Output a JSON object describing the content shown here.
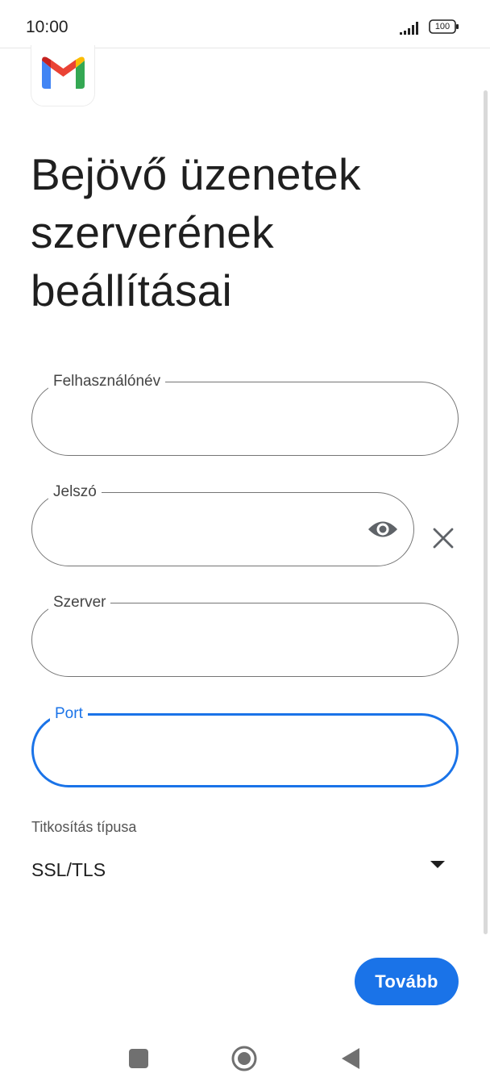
{
  "status_bar": {
    "time": "10:00",
    "battery": "100",
    "signal_icon": "signal-bars-icon",
    "battery_icon": "battery-icon"
  },
  "app": {
    "icon": "gmail-logo-icon"
  },
  "page": {
    "title": "Bejövő üzenetek szerverének beállításai"
  },
  "form": {
    "username": {
      "label": "Felhasználónév",
      "value": ""
    },
    "password": {
      "label": "Jelszó",
      "value": "",
      "visibility_icon": "eye-icon",
      "clear_icon": "close-icon"
    },
    "server": {
      "label": "Szerver",
      "value": ""
    },
    "port": {
      "label": "Port",
      "value": "",
      "focused": true
    },
    "encryption": {
      "label": "Titkosítás típusa",
      "value": "SSL/TLS",
      "dropdown_icon": "dropdown-arrow-icon"
    }
  },
  "actions": {
    "next_label": "Tovább"
  },
  "nav_bar": {
    "recent_icon": "recent-apps-icon",
    "home_icon": "home-icon",
    "back_icon": "back-icon"
  },
  "colors": {
    "accent": "#1a73e8",
    "outline": "#757575",
    "text": "#1f1f1f"
  }
}
